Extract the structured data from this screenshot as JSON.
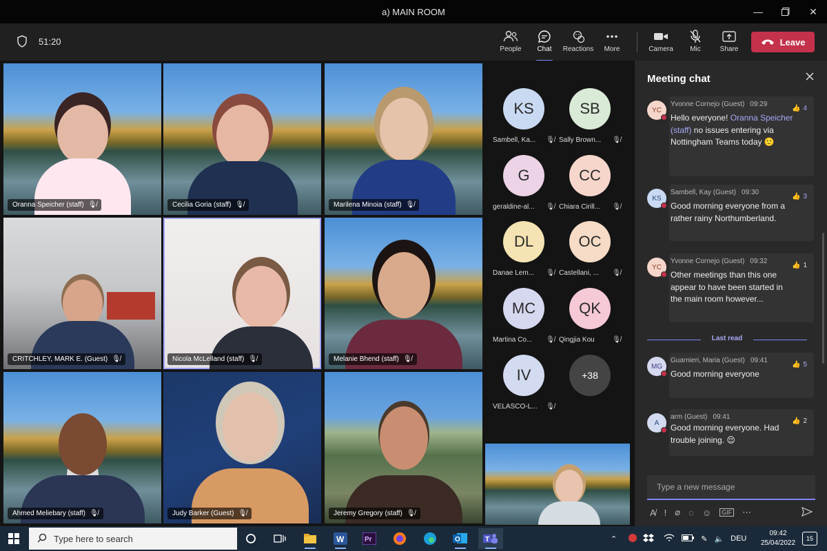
{
  "window": {
    "title": "a) MAIN ROOM",
    "controls": [
      "minimize",
      "maximize",
      "close"
    ]
  },
  "toolbar": {
    "timer": "51:20",
    "buttons": [
      {
        "label": "People",
        "icon": "people-icon"
      },
      {
        "label": "Chat",
        "icon": "chat-icon"
      },
      {
        "label": "Reactions",
        "icon": "reactions-icon"
      },
      {
        "label": "More",
        "icon": "more-icon"
      },
      {
        "label": "Camera",
        "icon": "camera-icon"
      },
      {
        "label": "Mic",
        "icon": "mic-off-icon"
      },
      {
        "label": "Share",
        "icon": "share-icon"
      }
    ],
    "leave_label": "Leave",
    "colors": {
      "leave": "#c4314b",
      "accent": "#7f85f5"
    }
  },
  "videos": [
    {
      "name": "Oranna Speicher (staff)"
    },
    {
      "name": "Cecilia Goria (staff)"
    },
    {
      "name": "Marilena Minoia (staff)"
    },
    {
      "name": "CRITCHLEY, MARK E. (Guest)"
    },
    {
      "name": "Nicola McLelland (staff)"
    },
    {
      "name": "Melanie Bhend (staff)"
    },
    {
      "name": "Ahmed Meliebary (staff)"
    },
    {
      "name": "Judy Barker (Guest)"
    },
    {
      "name": "Jeremy Gregory (staff)"
    }
  ],
  "roster": [
    {
      "initials": "KS",
      "name": "Sambell, Ka...",
      "color": "#c9d9f2"
    },
    {
      "initials": "SB",
      "name": "Sally Brown...",
      "color": "#d9ead6"
    },
    {
      "initials": "G",
      "name": "geraldine-al...",
      "color": "#ecd3e6"
    },
    {
      "initials": "CC",
      "name": "Chiara Cirill...",
      "color": "#f6d6cb"
    },
    {
      "initials": "DL",
      "name": "Danae Lem...",
      "color": "#f5e3b3"
    },
    {
      "initials": "OC",
      "name": "Castellani, ...",
      "color": "#f6dcc6"
    },
    {
      "initials": "MC",
      "name": "Martina Co...",
      "color": "#d6d8f0"
    },
    {
      "initials": "QK",
      "name": "Qingjia Kou",
      "color": "#f5c9d6"
    },
    {
      "initials": "IV",
      "name": "VELASCO-L...",
      "color": "#d3dbf0"
    }
  ],
  "roster_more": "+38",
  "chat": {
    "title": "Meeting chat",
    "messages": [
      {
        "initials": "YC",
        "author": "Yvonne Cornejo (Guest)",
        "time": "09:29",
        "likes": "4",
        "text_a": "Hello everyone! ",
        "mention": "Oranna Speicher (staff)",
        "text_b": " no issues entering via Nottingham Teams today",
        "emoji": "🙂"
      },
      {
        "initials": "KS",
        "author": "Sambell, Kay (Guest)",
        "time": "09:30",
        "likes": "3",
        "text": "Good morning everyone from a rather rainy Northumberland."
      },
      {
        "initials": "YC",
        "author": "Yvonne Cornejo (Guest)",
        "time": "09:32",
        "likes": "1",
        "text": "Other meetings than this one appear to have been started in the main room however..."
      },
      {
        "initials": "MG",
        "author": "Guarnieri, Maria (Guest)",
        "time": "09:41",
        "likes": "5",
        "text": "Good morning everyone"
      },
      {
        "initials": "A",
        "author": "arm (Guest)",
        "time": "09:41",
        "likes": "2",
        "text": "Good morning everyone. Had trouble joining.",
        "emoji": "😌"
      }
    ],
    "last_read": "Last read",
    "compose_placeholder": "Type a new message"
  },
  "taskbar": {
    "search_placeholder": "Type here to search",
    "language": "DEU",
    "time": "09:42",
    "date": "25/04/2022",
    "notifications": "15"
  }
}
